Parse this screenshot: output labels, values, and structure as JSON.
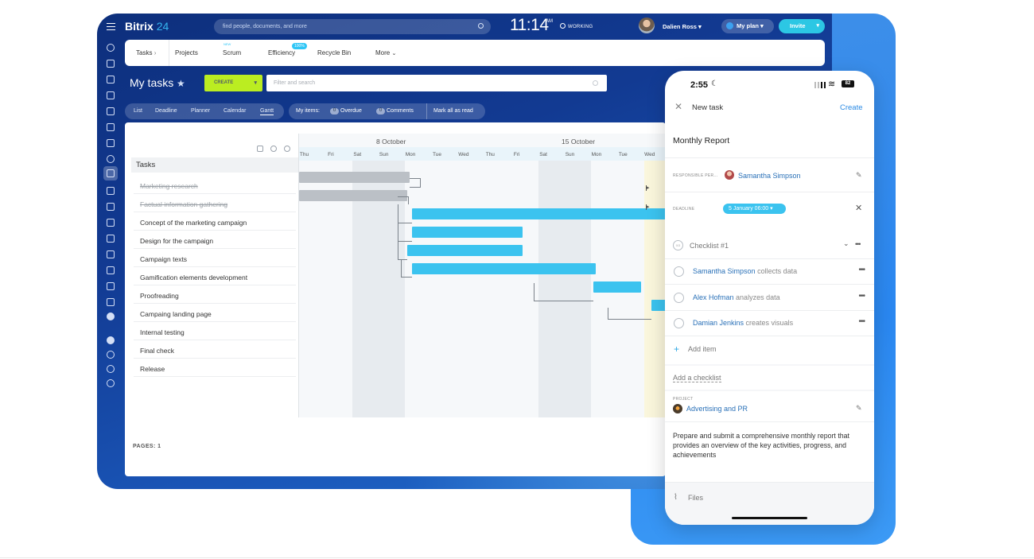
{
  "brand": {
    "name": "Bitrix",
    "num": "24"
  },
  "topbar": {
    "search_placeholder": "find people, documents, and more",
    "time": "11:14",
    "ampm": "AM",
    "status": "WORKING",
    "user_name": "Dalien Ross",
    "my_plan": "My plan",
    "invite": "Invite"
  },
  "tabs": {
    "tasks": "Tasks",
    "projects": "Projects",
    "scrum": "Scrum",
    "scrum_badge": "NEW",
    "efficiency": "Efficiency",
    "efficiency_badge": "100%",
    "recycle": "Recycle Bin",
    "more": "More"
  },
  "page": {
    "title": "My tasks",
    "create": "CREATE",
    "filter_placeholder": "Filter and search"
  },
  "views": [
    "List",
    "Deadline",
    "Planner",
    "Calendar",
    "Gantt"
  ],
  "counters": {
    "label": "My items:",
    "overdue_count": "0",
    "overdue": "Overdue",
    "comments_count": "0",
    "comments": "Comments",
    "mark_read": "Mark all as read"
  },
  "gantt": {
    "header": "Tasks",
    "weeks": [
      "8 October",
      "15 October"
    ],
    "days": [
      "Thu",
      "Fri",
      "Sat",
      "Sun",
      "Mon",
      "Tue",
      "Wed",
      "Thu",
      "Fri",
      "Sat",
      "Sun",
      "Mon",
      "Tue",
      "Wed"
    ],
    "tasks": [
      {
        "name": "Marketing research",
        "done": true
      },
      {
        "name": "Factual information gathering",
        "done": true
      },
      {
        "name": "Concept of the marketing campaign",
        "done": false
      },
      {
        "name": "Design for the campaign",
        "done": false
      },
      {
        "name": "Campaign texts",
        "done": false
      },
      {
        "name": "Gamification elements development",
        "done": false
      },
      {
        "name": "Proofreading",
        "done": false
      },
      {
        "name": "Campaing landing page",
        "done": false
      },
      {
        "name": "Internal testing",
        "done": false
      },
      {
        "name": "Final check",
        "done": false
      },
      {
        "name": "Release",
        "done": false
      }
    ],
    "pages_label": "PAGES:",
    "pages_value": "1"
  },
  "phone": {
    "time": "2:55",
    "battery": "82",
    "close": "✕",
    "title": "New task",
    "create": "Create",
    "task_name": "Monthly Report",
    "responsible_label": "RESPONSIBLE PER...",
    "responsible": "Samantha Simpson",
    "deadline_label": "DEADLINE",
    "deadline": "5 January 06:00",
    "checklist_badge": "0/3",
    "checklist_title": "Checklist #1",
    "checklist": [
      {
        "person": "Samantha Simpson",
        "action": "collects data"
      },
      {
        "person": "Alex Hofman",
        "action": "analyzes data"
      },
      {
        "person": "Damian Jenkins",
        "action": "creates visuals"
      }
    ],
    "add_item": "Add item",
    "add_checklist": "Add a checklist",
    "project_label": "PROJECT",
    "project": "Advertising and PR",
    "description": "Prepare and submit a comprehensive monthly report that provides an overview of the key activities, progress, and achievements",
    "files": "Files"
  },
  "colors": {
    "accent": "#2fc6f6",
    "create": "#bbed21",
    "sidebar": "#0d2f7c",
    "phone_bg": "#3f8fe8"
  }
}
